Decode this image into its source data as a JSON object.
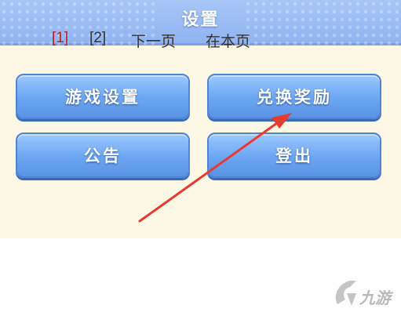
{
  "header": {
    "title": "设置"
  },
  "buttons": {
    "game_settings": "游戏设置",
    "redeem_rewards": "兑换奖励",
    "announcement": "公告",
    "logout": "登出"
  },
  "pagination": {
    "page1": "[1]",
    "page2": "[2]",
    "next": "下一页",
    "in_page": "在本页"
  },
  "watermark": {
    "text": "九游",
    "icon": "nine-game-logo"
  },
  "colors": {
    "header": "#8fb3f1",
    "panel_bg": "#fdf8e6",
    "button": "#6ba6f2",
    "arrow": "#e83a2e",
    "current_page": "#b22222"
  }
}
